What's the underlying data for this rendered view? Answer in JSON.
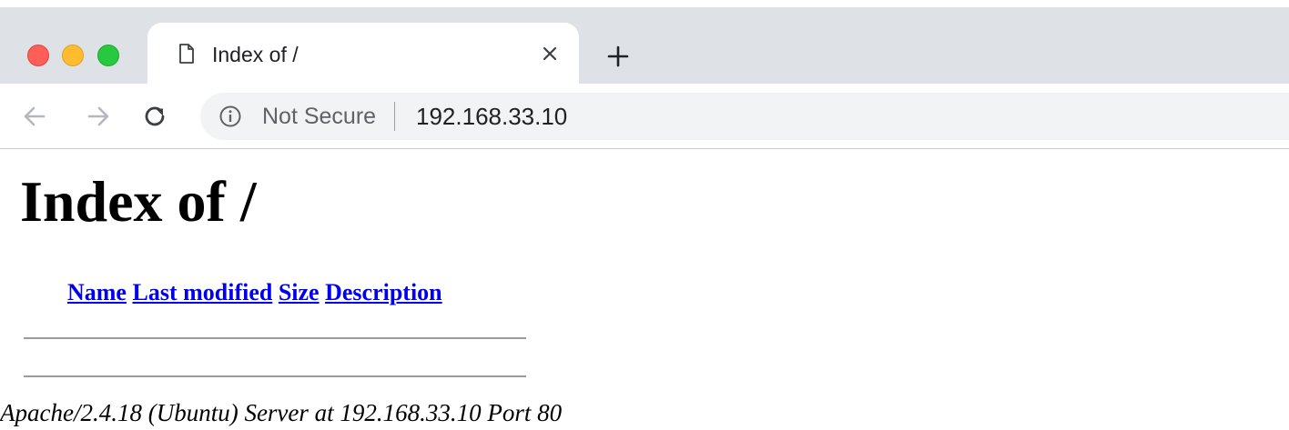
{
  "tab": {
    "title": "Index of /",
    "close_symbol": "×",
    "new_tab_symbol": "+",
    "favicon": "document-icon"
  },
  "toolbar": {
    "back_icon": "arrow-left-icon",
    "forward_icon": "arrow-right-icon",
    "reload_icon": "reload-icon",
    "security_icon": "info-icon",
    "security_label": "Not Secure",
    "url": "192.168.33.10"
  },
  "page": {
    "title": "Index of /",
    "columns": [
      "Name",
      "Last modified",
      "Size",
      "Description"
    ],
    "rows": [],
    "server_signature": "Apache/2.4.18 (Ubuntu) Server at 192.168.33.10 Port 80"
  },
  "colors": {
    "tab_strip": "#dee1e6",
    "omnibox": "#f1f3f4",
    "link": "#0000ee",
    "close_red": "#ff5f57",
    "minimize_yellow": "#febc2e",
    "zoom_green": "#28c840"
  }
}
